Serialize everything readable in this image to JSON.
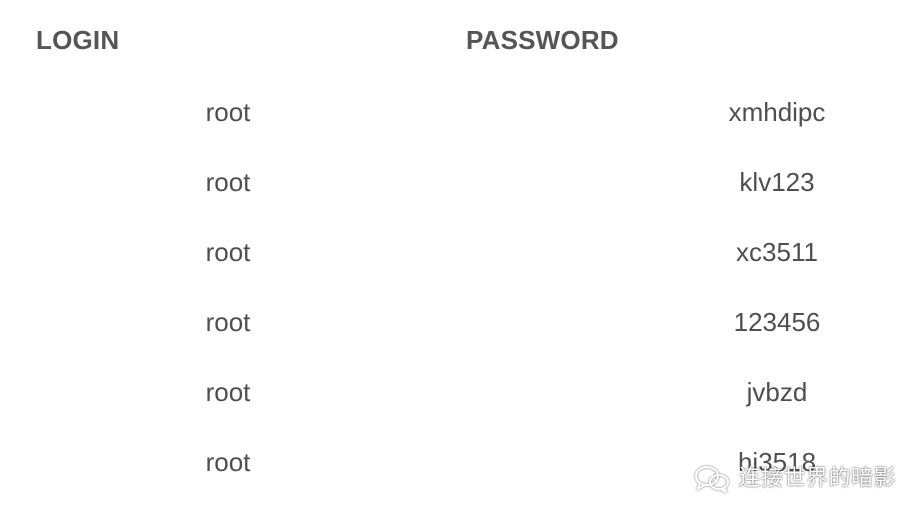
{
  "table": {
    "headers": {
      "login": "LOGIN",
      "password": "PASSWORD"
    },
    "rows": [
      {
        "login": "root",
        "password": "xmhdipc"
      },
      {
        "login": "root",
        "password": "klv123"
      },
      {
        "login": "root",
        "password": "xc3511"
      },
      {
        "login": "root",
        "password": "123456"
      },
      {
        "login": "root",
        "password": "jvbzd"
      },
      {
        "login": "root",
        "password": "hi3518"
      }
    ]
  },
  "watermark": {
    "icon": "wechat-icon",
    "text": "连接世界的暗影"
  }
}
